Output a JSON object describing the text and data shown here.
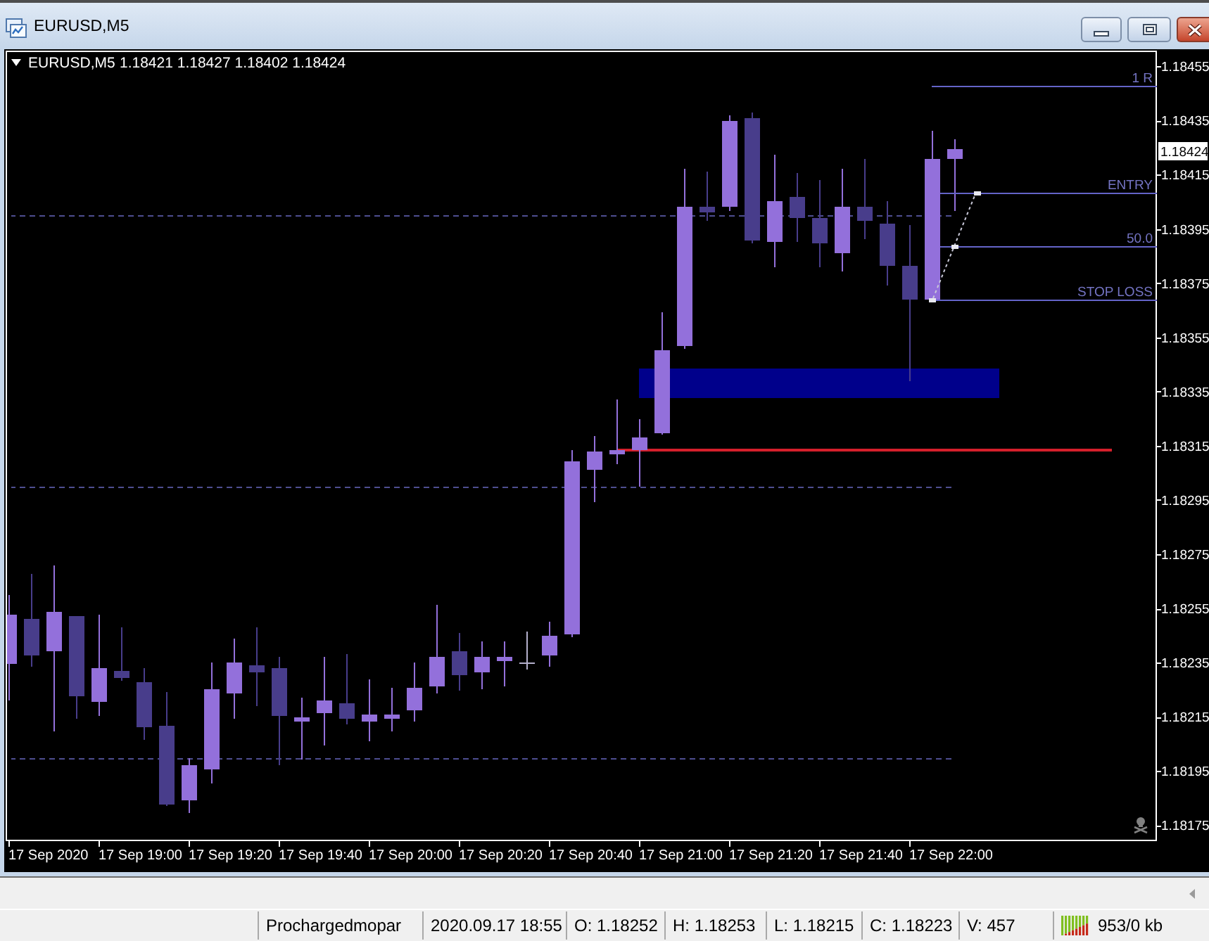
{
  "window": {
    "title": "EURUSD,M5"
  },
  "chart": {
    "symbol": "EURUSD,M5",
    "quote": "1.18421 1.18427 1.18402 1.18424",
    "price_labels": [
      "1.18455",
      "1.18435",
      "1.18415",
      "1.18395",
      "1.18375",
      "1.18355",
      "1.18335",
      "1.18315",
      "1.18295",
      "1.18275",
      "1.18255",
      "1.18235",
      "1.18215",
      "1.18195",
      "1.18175"
    ],
    "current_price": "1.18424",
    "time_labels": [
      "17 Sep 2020",
      "17 Sep 19:00",
      "17 Sep 19:20",
      "17 Sep 19:40",
      "17 Sep 20:00",
      "17 Sep 20:20",
      "17 Sep 20:40",
      "17 Sep 21:00",
      "17 Sep 21:20",
      "17 Sep 21:40",
      "17 Sep 22:00"
    ],
    "fib_levels": [
      {
        "label": "1 R"
      },
      {
        "label": "ENTRY"
      },
      {
        "label": "50.0"
      },
      {
        "label": "STOP LOSS"
      }
    ]
  },
  "status_bar": {
    "profile": "Prochargedmopar",
    "datetime": "2020.09.17 18:55",
    "open": "O: 1.18252",
    "high": "H: 1.18253",
    "low": "L: 1.18215",
    "close": "C: 1.18223",
    "volume": "V: 457",
    "traffic": "953/0 kb"
  }
}
